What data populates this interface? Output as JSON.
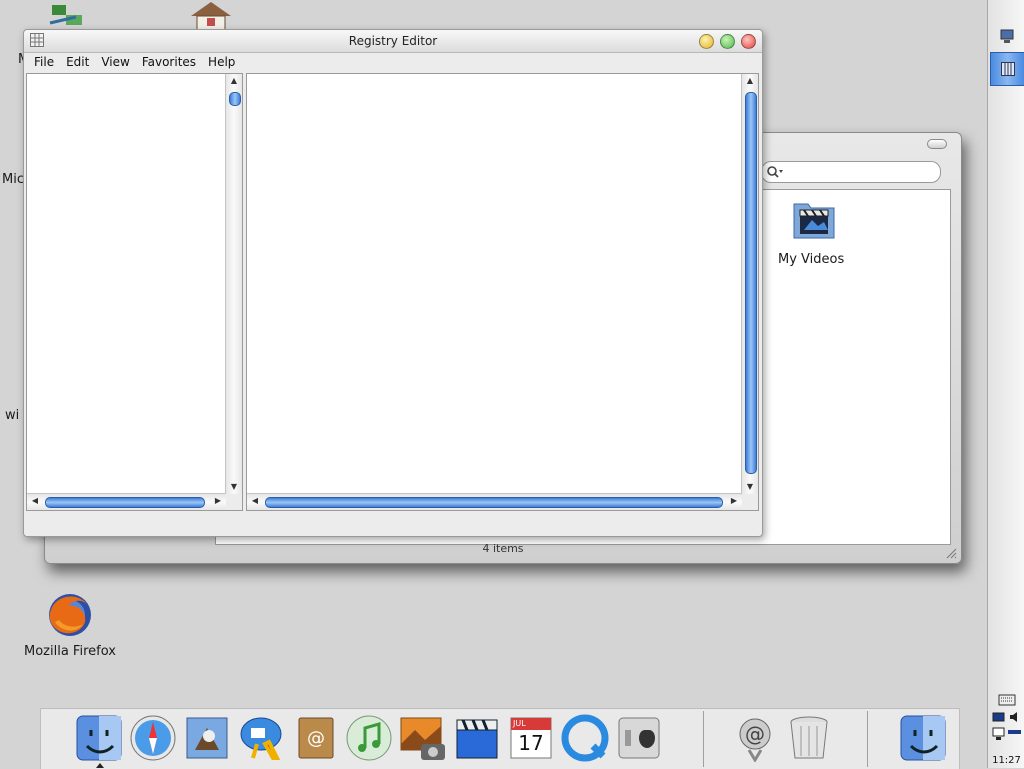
{
  "desktop": {
    "icons": [
      {
        "label": "Mozilla Firefox",
        "icon": "firefox-icon"
      },
      {
        "label": "Mic",
        "icon": "partial-icon"
      },
      {
        "label": "wi",
        "icon": "partial-icon"
      },
      {
        "label": "M",
        "icon": "partial-icon"
      }
    ]
  },
  "explorer": {
    "items": [
      {
        "label": "My Videos",
        "icon": "my-videos-folder-icon"
      }
    ],
    "status": "4 items"
  },
  "regedit": {
    "title": "Registry Editor",
    "menu": [
      "File",
      "Edit",
      "View",
      "Favorites",
      "Help"
    ]
  },
  "taskbar": {
    "clock": "11:27"
  },
  "dock": {
    "items": [
      "finder-icon",
      "safari-icon",
      "mail-icon",
      "ichat-icon",
      "address-book-icon",
      "itunes-icon",
      "iphoto-icon",
      "imovie-icon",
      "ical-icon",
      "quicktime-icon",
      "system-preferences-icon",
      "mail-at-icon",
      "trash-icon",
      "finder-icon"
    ],
    "ical_month": "JUL",
    "ical_day": "17"
  },
  "colors": {
    "accent_blue": "#3e7ed8",
    "close": "#e0443e",
    "minimize": "#e3b12a",
    "zoom": "#4fb84a"
  }
}
